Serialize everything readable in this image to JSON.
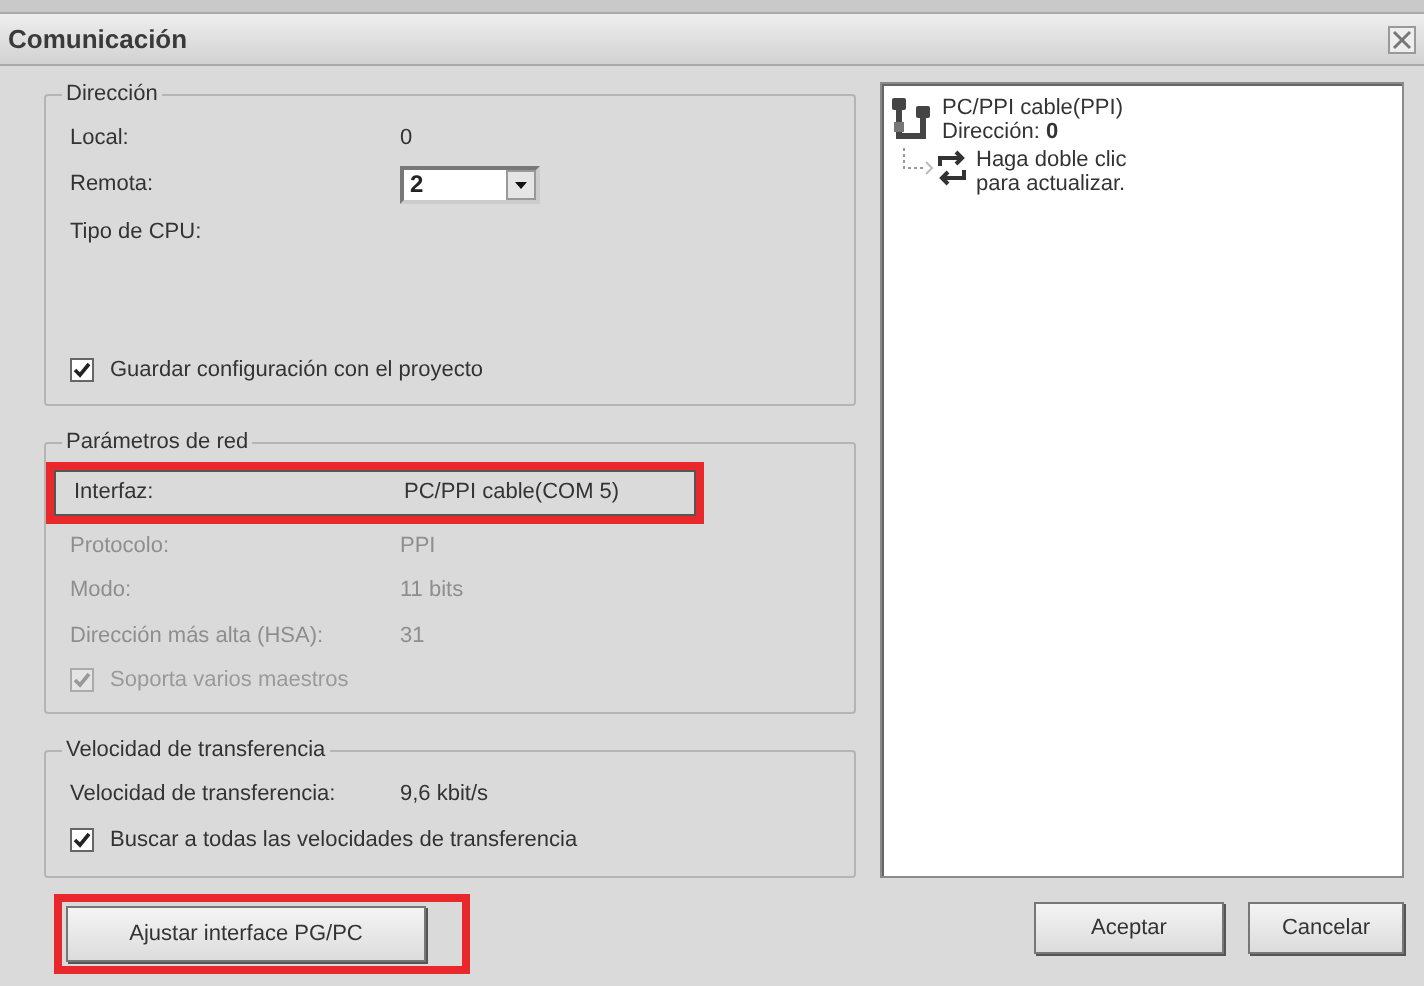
{
  "window": {
    "title": "Comunicación"
  },
  "address_group": {
    "title": "Dirección",
    "rows": [
      {
        "kind": "text",
        "label": "Local:",
        "value": "0"
      },
      {
        "kind": "dropdown",
        "label": "Remota:",
        "value": "2"
      },
      {
        "kind": "text",
        "label": "Tipo de CPU:"
      }
    ],
    "checkbox": {
      "label": "Guardar configuración con el proyecto",
      "checked": true,
      "disabled": false
    }
  },
  "network_group": {
    "title": "Parámetros de red",
    "rows": [
      {
        "kind": "text",
        "label": "Interfaz:",
        "value": "PC/PPI cable(COM 5)",
        "highlighted": true,
        "disabled": false
      },
      {
        "kind": "text",
        "label": "Protocolo:",
        "value": "PPI",
        "highlighted": false,
        "disabled": true
      },
      {
        "kind": "text",
        "label": "Modo:",
        "value": "11 bits",
        "highlighted": false,
        "disabled": true
      },
      {
        "kind": "text",
        "label": "Dirección más alta (HSA):",
        "value": "31",
        "highlighted": false,
        "disabled": true
      }
    ],
    "checkbox": {
      "label": "Soporta varios maestros",
      "checked": true,
      "disabled": true
    }
  },
  "speed_group": {
    "title": "Velocidad de transferencia",
    "rows": [
      {
        "kind": "text",
        "label": "Velocidad de transferencia:",
        "value": "9,6 kbit/s"
      }
    ],
    "checkbox": {
      "label": "Buscar a todas las velocidades de transferencia",
      "checked": true,
      "disabled": false
    }
  },
  "adjust_button": {
    "label": "Ajustar interface PG/PC",
    "highlighted": true
  },
  "tree": {
    "items": [
      {
        "kind": "cable",
        "title": "PC/PPI cable(PPI)",
        "subtitle": "Dirección: **0**",
        "children": [
          {
            "kind": "refresh",
            "title": "Haga doble clic para actualizar."
          }
        ]
      }
    ]
  },
  "buttons": [
    {
      "label": "Aceptar"
    },
    {
      "label": "Cancelar"
    }
  ]
}
